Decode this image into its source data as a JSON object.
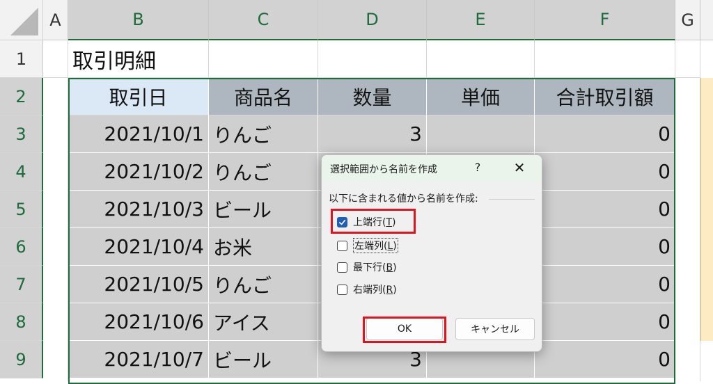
{
  "columns": [
    "A",
    "B",
    "C",
    "D",
    "E",
    "F",
    "G"
  ],
  "rows": [
    "1",
    "2",
    "3",
    "4",
    "5",
    "6",
    "7",
    "8",
    "9"
  ],
  "title_cell": "取引明細",
  "table_headers": [
    "取引日",
    "商品名",
    "数量",
    "単価",
    "合計取引額"
  ],
  "table_rows": [
    {
      "date": "2021/10/1",
      "item": "りんご",
      "qty": "3",
      "price": "",
      "total": "0"
    },
    {
      "date": "2021/10/2",
      "item": "りんご",
      "qty": "",
      "price": "",
      "total": "0"
    },
    {
      "date": "2021/10/3",
      "item": "ビール",
      "qty": "",
      "price": "",
      "total": "0"
    },
    {
      "date": "2021/10/4",
      "item": "お米",
      "qty": "",
      "price": "",
      "total": "0"
    },
    {
      "date": "2021/10/5",
      "item": "りんご",
      "qty": "",
      "price": "",
      "total": "0"
    },
    {
      "date": "2021/10/6",
      "item": "アイス",
      "qty": "",
      "price": "",
      "total": "0"
    },
    {
      "date": "2021/10/7",
      "item": "ビール",
      "qty": "3",
      "price": "",
      "total": "0"
    }
  ],
  "dialog": {
    "title": "選択範囲から名前を作成",
    "help": "?",
    "close": "✕",
    "label": "以下に含まれる値から名前を作成:",
    "options": [
      {
        "pre": "上端行(",
        "key": "T",
        "post": ")",
        "checked": true
      },
      {
        "pre": "左端列(",
        "key": "L",
        "post": ")",
        "checked": false
      },
      {
        "pre": "最下行(",
        "key": "B",
        "post": ")",
        "checked": false
      },
      {
        "pre": "右端列(",
        "key": "R",
        "post": ")",
        "checked": false
      }
    ],
    "ok": "OK",
    "cancel": "キャンセル"
  },
  "colors": {
    "selection": "#1e6b3c",
    "highlight": "#e0141e",
    "checkbox": "#1f5fb8"
  }
}
